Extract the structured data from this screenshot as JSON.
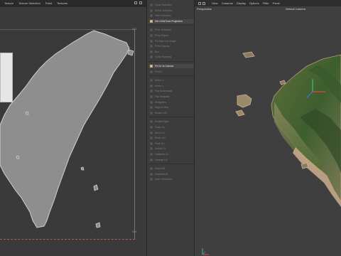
{
  "uv_editor": {
    "menu": [
      "Texture",
      "Texture Selection",
      "Paint",
      "Textures"
    ],
    "axis_top_right": "1.0",
    "axis_bottom_right": "1.0"
  },
  "palette": {
    "items": [
      {
        "label": "Grow Selection"
      },
      {
        "label": "Shrink Selection"
      },
      {
        "label": "Hide Selection"
      },
      {
        "label": "Set UVW from Projection",
        "active": true
      },
      {
        "label": "Fit to Selection"
      },
      {
        "label": "Fit to Object"
      },
      {
        "label": "Fit Object to Image"
      },
      {
        "label": "Fit to Canvas"
      },
      {
        "label": "Box"
      },
      {
        "label": "Cubic Mapping"
      },
      {
        "label": "Fit UV to Canvas",
        "active": true
      },
      {
        "label": "Fit UV"
      },
      {
        "label": "Mirror U"
      },
      {
        "label": "Mirror V"
      },
      {
        "label": "Flip Horizontally"
      },
      {
        "label": "Flip Vertically"
      },
      {
        "label": "Straighten"
      },
      {
        "label": "Align to Grid"
      },
      {
        "label": "Rotate Left"
      },
      {
        "label": "Rotate Right"
      },
      {
        "label": "Scale UV"
      },
      {
        "label": "Move UV"
      },
      {
        "label": "Relax UV"
      },
      {
        "label": "Pack UV"
      },
      {
        "label": "Unfold UV"
      },
      {
        "label": "Optimize UV"
      },
      {
        "label": "Unwrap UV"
      },
      {
        "label": "Select All"
      },
      {
        "label": "Deselect All"
      },
      {
        "label": "Invert Selection"
      }
    ]
  },
  "viewport": {
    "menu": [
      "View",
      "Cameras",
      "Display",
      "Options",
      "Filter",
      "Panel"
    ],
    "name": "Perspective",
    "camera": "Default Camera"
  },
  "colors": {
    "uv_island": "#8e8e8e",
    "active_icon": "#e4c79a"
  }
}
